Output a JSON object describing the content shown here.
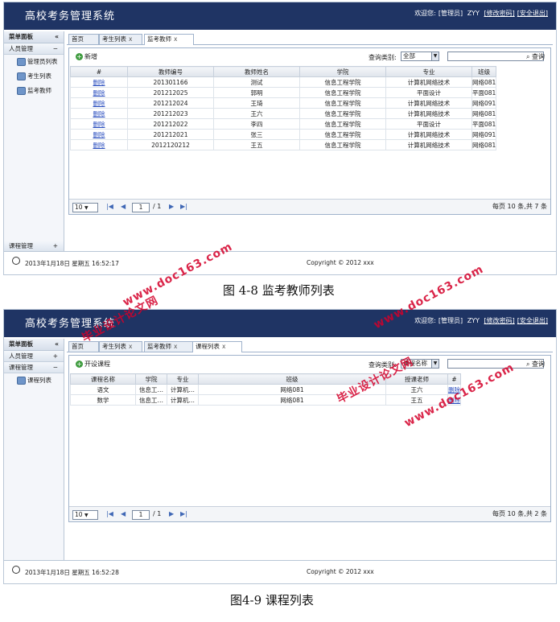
{
  "app_title": "高校考务管理系统",
  "user_bar": {
    "welcome": "欢迎您:",
    "role": "[管理员]",
    "name": "ZYY",
    "change_pwd": "[修改密码]",
    "logout": "[安全退出]"
  },
  "sidebar": {
    "title": "菜单面板",
    "collapse": "«",
    "group_people": "人员管理",
    "group_course": "课程管理",
    "items": [
      "管理员列表",
      "考生列表",
      "监考教师"
    ],
    "course_items": [
      "课程列表"
    ],
    "minus": "−",
    "plus": "+"
  },
  "footer": {
    "datetime1": "2013年1月18日 星期五 16:52:17",
    "datetime2": "2013年1月18日 星期五 16:52:28",
    "copyright": "Copyright © 2012 xxx"
  },
  "screen1": {
    "tabs": [
      "首页",
      "考生列表",
      "监考教师"
    ],
    "tab_close": "x",
    "add_label": "新增",
    "query_label": "查询类别:",
    "query_value": "全部",
    "search_label": "查询",
    "columns": [
      "#",
      "教师编号",
      "教师姓名",
      "学院",
      "专业",
      "班级"
    ],
    "rows": [
      [
        "删除",
        "201301166",
        "测试",
        "信息工程学院",
        "计算机网络技术",
        "网络081"
      ],
      [
        "删除",
        "201212025",
        "郭明",
        "信息工程学院",
        "平面设计",
        "平面081"
      ],
      [
        "删除",
        "201212024",
        "王琦",
        "信息工程学院",
        "计算机网络技术",
        "网络091"
      ],
      [
        "删除",
        "201212023",
        "王六",
        "信息工程学院",
        "计算机网络技术",
        "网络081"
      ],
      [
        "删除",
        "201212022",
        "李四",
        "信息工程学院",
        "平面设计",
        "平面081"
      ],
      [
        "删除",
        "201212021",
        "张三",
        "信息工程学院",
        "计算机网络技术",
        "网络091"
      ],
      [
        "删除",
        "2012120212",
        "王五",
        "信息工程学院",
        "计算机网络技术",
        "网络081"
      ]
    ],
    "page_size": "10",
    "page_num": "1",
    "page_total": "/ 1",
    "page_info": "每页 10 条,共 7 条"
  },
  "caption1": "图 4-8 监考教师列表",
  "screen2": {
    "tabs": [
      "首页",
      "考生列表",
      "监考教师",
      "课程列表"
    ],
    "add_label": "开设课程",
    "query_label": "查询类别:",
    "query_value": "课程名称",
    "search_label": "查询",
    "columns": [
      "课程名称",
      "学院",
      "专业",
      "班级",
      "授课老师",
      "#"
    ],
    "rows": [
      [
        "语文",
        "信息工…",
        "计算机…",
        "网络081",
        "王六",
        "删除"
      ],
      [
        "数学",
        "信息工…",
        "计算机…",
        "网络081",
        "王五",
        "删除"
      ]
    ],
    "page_size": "10",
    "page_num": "1",
    "page_total": "/ 1",
    "page_info": "每页 10 条,共 2 条"
  },
  "caption2": "图4-9 课程列表",
  "watermarks": [
    "www.doc163.com",
    "毕业设计论文网"
  ]
}
